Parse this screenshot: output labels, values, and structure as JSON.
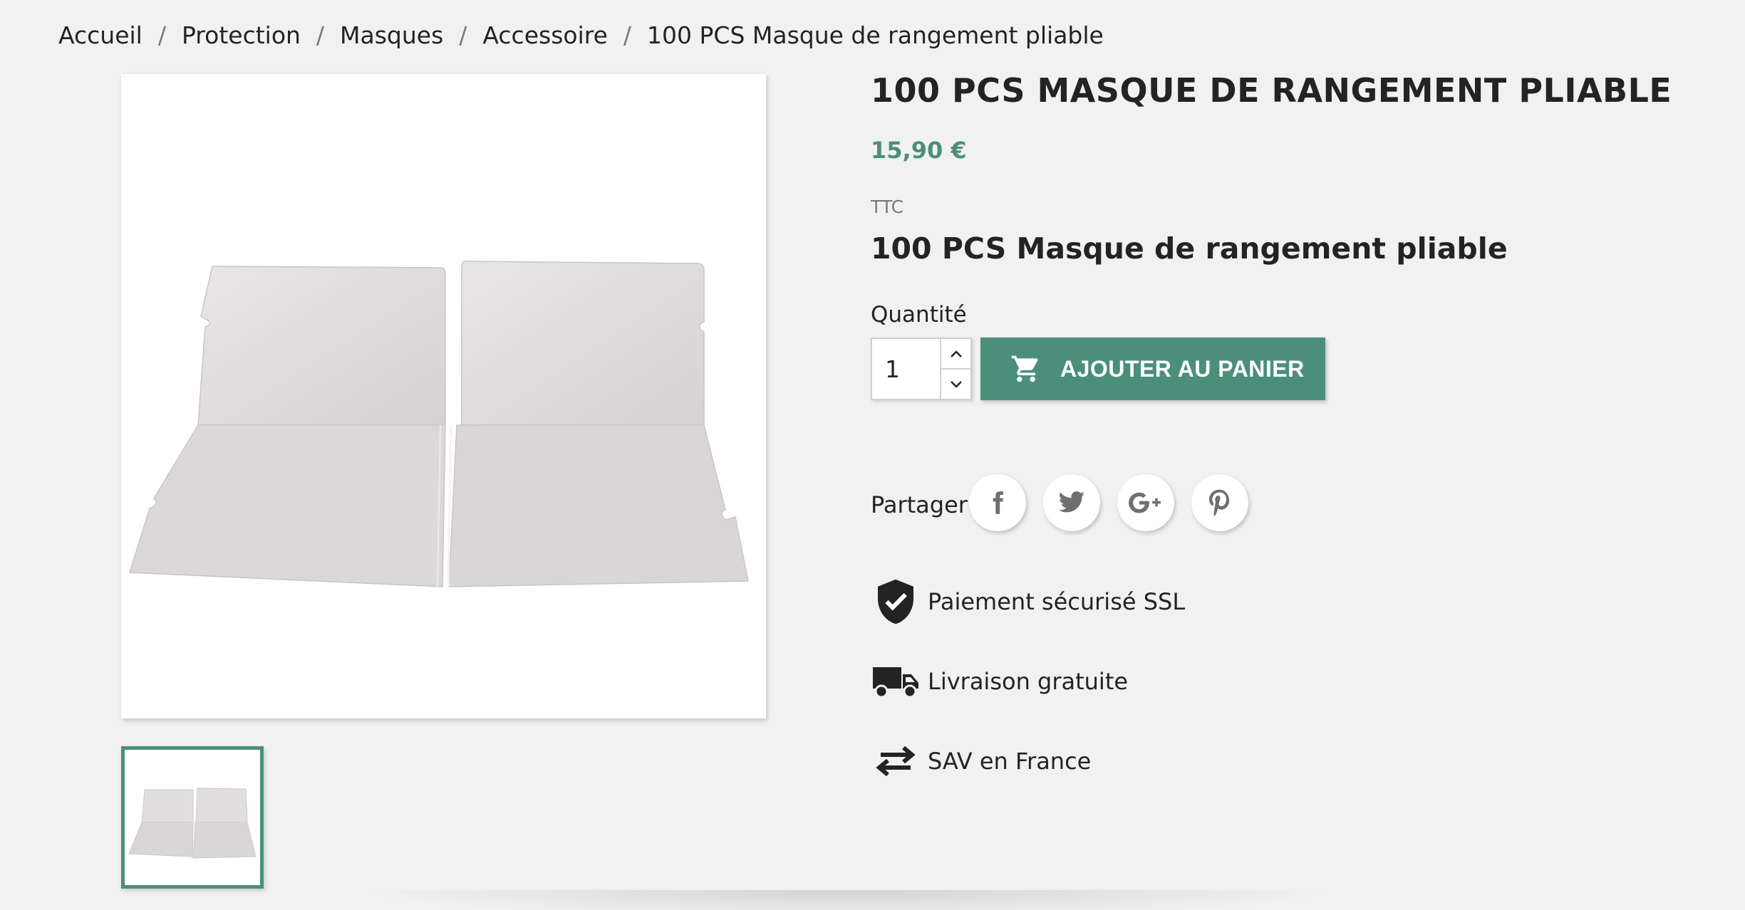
{
  "breadcrumb": {
    "items": [
      "Accueil",
      "Protection",
      "Masques",
      "Accessoire",
      "100 PCS Masque de rangement pliable"
    ],
    "separator": "/"
  },
  "product": {
    "title": "100 PCS MASQUE DE RANGEMENT PLIABLE",
    "price": "15,90 €",
    "tax_label": "TTC",
    "short_description": "100 PCS Masque de rangement pliable"
  },
  "quantity": {
    "label": "Quantité",
    "value": "1"
  },
  "add_to_cart": {
    "label": "AJOUTER AU PANIER",
    "icon": "cart-icon"
  },
  "share": {
    "label": "Partager",
    "networks": [
      "facebook-icon",
      "twitter-icon",
      "google-plus-icon",
      "pinterest-icon"
    ]
  },
  "reassurance": [
    {
      "icon": "shield-check-icon",
      "text": "Paiement sécurisé SSL"
    },
    {
      "icon": "truck-icon",
      "text": "Livraison gratuite"
    },
    {
      "icon": "exchange-arrows-icon",
      "text": "SAV en France"
    }
  ],
  "colors": {
    "accent": "#4b8f7b",
    "text": "#232323",
    "background": "#f1f1f1"
  }
}
